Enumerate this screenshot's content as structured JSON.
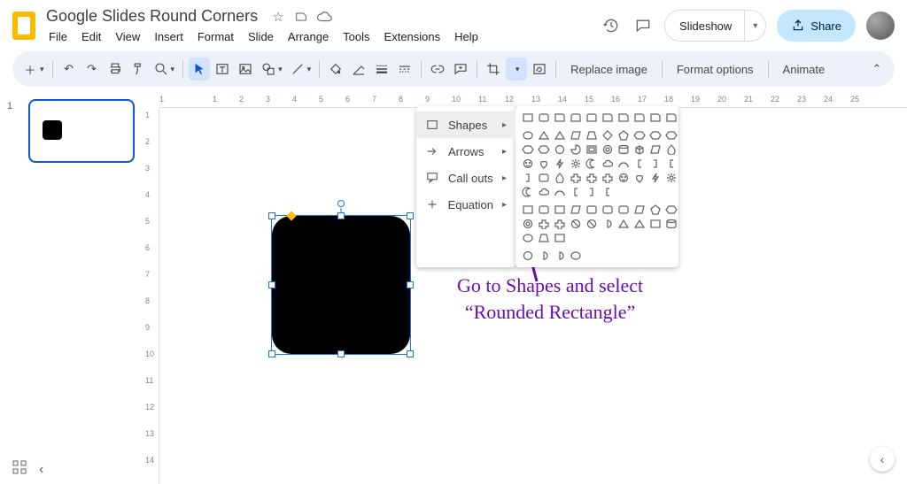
{
  "header": {
    "doc_title": "Google Slides Round Corners",
    "menu": [
      "File",
      "Edit",
      "View",
      "Insert",
      "Format",
      "Slide",
      "Arrange",
      "Tools",
      "Extensions",
      "Help"
    ],
    "slideshow_label": "Slideshow",
    "share_label": "Share"
  },
  "toolbar": {
    "replace_image": "Replace image",
    "format_options": "Format options",
    "animate": "Animate"
  },
  "ruler": {
    "h": [
      "1",
      "",
      "1",
      "2",
      "3",
      "4",
      "5",
      "6",
      "7",
      "8",
      "9",
      "10",
      "11",
      "12",
      "13",
      "14",
      "15",
      "16",
      "17",
      "18",
      "19",
      "20",
      "21",
      "22",
      "23",
      "24",
      "25"
    ],
    "v": [
      "1",
      "2",
      "3",
      "4",
      "5",
      "6",
      "7",
      "8",
      "9",
      "10",
      "11",
      "12",
      "13",
      "14"
    ]
  },
  "film": {
    "slide_number": "1"
  },
  "shape_menu": {
    "items": [
      {
        "label": "Shapes",
        "icon": "rect"
      },
      {
        "label": "Arrows",
        "icon": "arrow"
      },
      {
        "label": "Call outs",
        "icon": "callout"
      },
      {
        "label": "Equation",
        "icon": "plus"
      }
    ]
  },
  "annotation": {
    "line1": "Go to Shapes and select",
    "line2": "“Rounded Rectangle”"
  }
}
